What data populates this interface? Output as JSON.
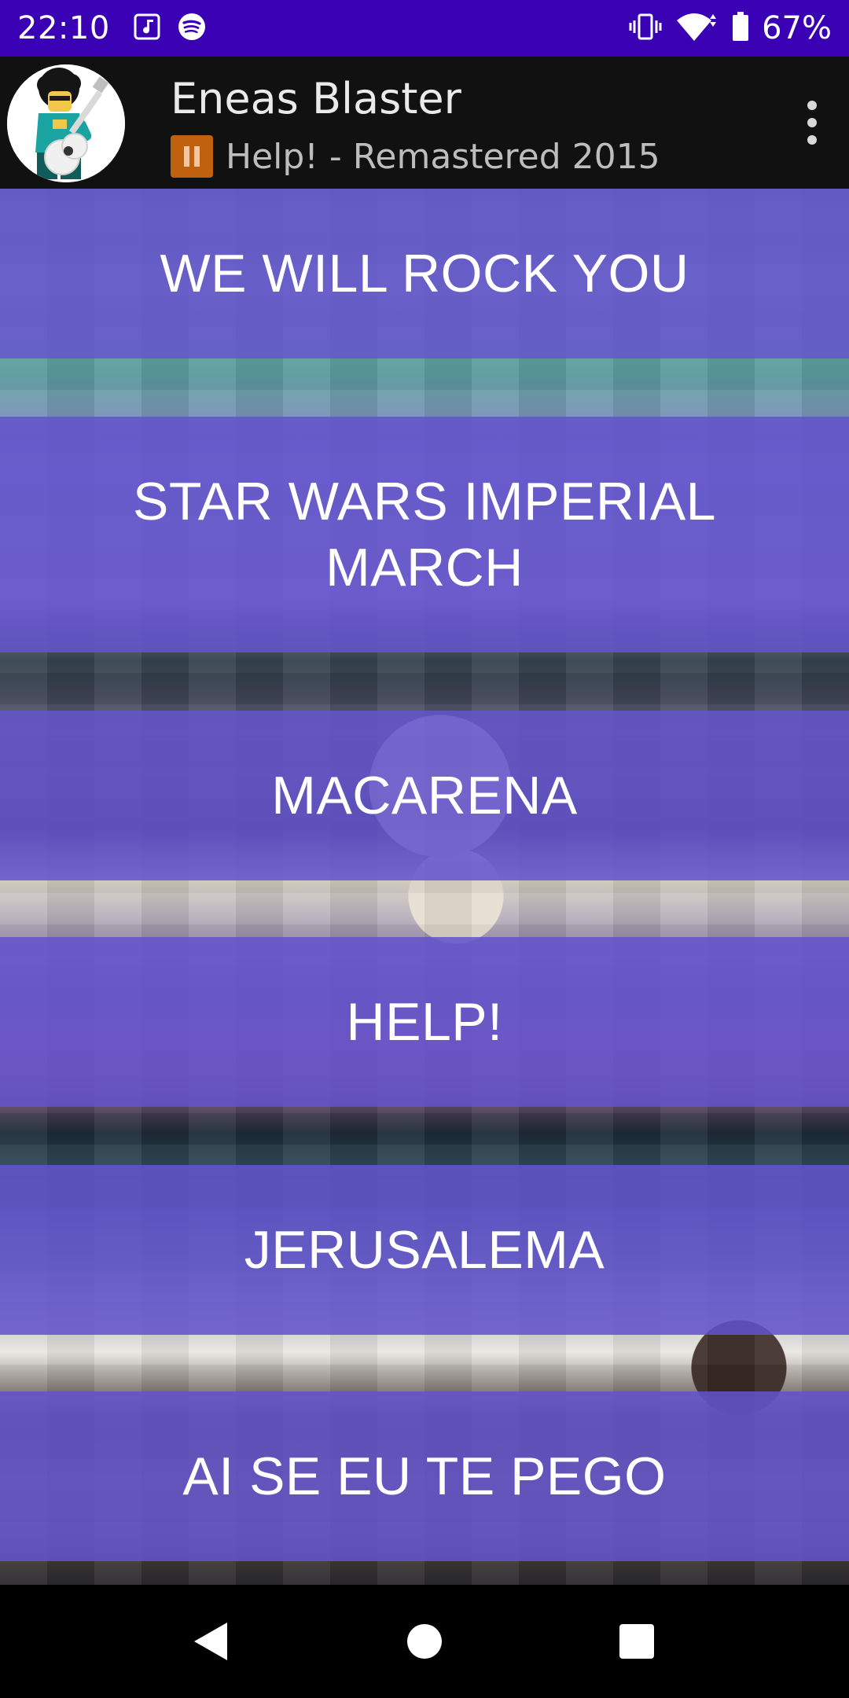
{
  "status_bar": {
    "time": "22:10",
    "battery": "67%",
    "icons": [
      "music-note-icon",
      "spotify-icon",
      "vibrate-icon",
      "wifi-icon",
      "battery-icon"
    ],
    "background_color": "#3a00b4"
  },
  "app_bar": {
    "title": "Eneas Blaster",
    "now_playing": "Help! - Remastered 2015",
    "playback_state": "paused",
    "background_color": "#111111"
  },
  "songs": [
    {
      "label": "WE WILL ROCK YOU"
    },
    {
      "label": "STAR WARS IMPERIAL MARCH"
    },
    {
      "label": "MACARENA"
    },
    {
      "label": "HELP!"
    },
    {
      "label": "JERUSALEMA"
    },
    {
      "label": "AI SE EU TE PEGO"
    }
  ],
  "song_button_color": "#6354cd",
  "nav_bar": {
    "buttons": [
      "back-icon",
      "home-icon",
      "recents-icon"
    ]
  }
}
